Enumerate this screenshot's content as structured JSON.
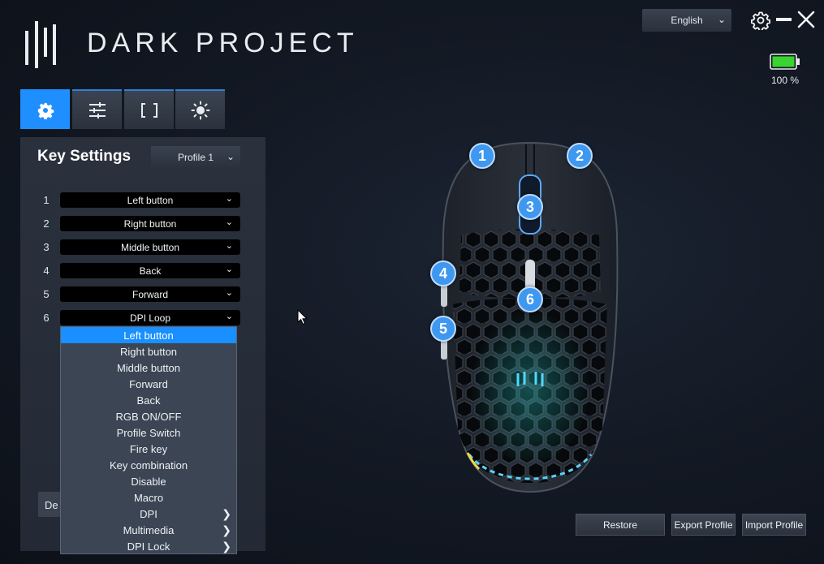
{
  "app": {
    "brand_name": "DARK PROJECT"
  },
  "header": {
    "language": "English",
    "battery_label": "100 %",
    "battery_level": 1.0,
    "battery_color": "#39d42f"
  },
  "tabs": [
    {
      "icon": "gear-icon",
      "active": true
    },
    {
      "icon": "sliders-icon",
      "active": false
    },
    {
      "icon": "brackets-icon",
      "active": false
    },
    {
      "icon": "sun-icon",
      "active": false
    }
  ],
  "key_settings": {
    "title": "Key Settings",
    "profile": "Profile 1",
    "keys": [
      {
        "number": "1",
        "value": "Left button"
      },
      {
        "number": "2",
        "value": "Right button"
      },
      {
        "number": "3",
        "value": "Middle button"
      },
      {
        "number": "4",
        "value": "Back"
      },
      {
        "number": "5",
        "value": "Forward"
      },
      {
        "number": "6",
        "value": "DPI Loop"
      }
    ],
    "default_button_partial": "De"
  },
  "dropdown": {
    "items": [
      {
        "label": "Left button",
        "selected": true,
        "submenu": false
      },
      {
        "label": "Right button",
        "selected": false,
        "submenu": false
      },
      {
        "label": "Middle button",
        "selected": false,
        "submenu": false
      },
      {
        "label": "Forward",
        "selected": false,
        "submenu": false
      },
      {
        "label": "Back",
        "selected": false,
        "submenu": false
      },
      {
        "label": "RGB ON/OFF",
        "selected": false,
        "submenu": false
      },
      {
        "label": "Profile Switch",
        "selected": false,
        "submenu": false
      },
      {
        "label": "Fire key",
        "selected": false,
        "submenu": false
      },
      {
        "label": "Key combination",
        "selected": false,
        "submenu": false
      },
      {
        "label": "Disable",
        "selected": false,
        "submenu": false
      },
      {
        "label": "Macro",
        "selected": false,
        "submenu": false
      },
      {
        "label": "DPI",
        "selected": false,
        "submenu": true
      },
      {
        "label": "Multimedia",
        "selected": false,
        "submenu": true
      },
      {
        "label": "DPI Lock",
        "selected": false,
        "submenu": true
      }
    ],
    "submenu_arrow": "❯"
  },
  "mouse_callouts": [
    "1",
    "2",
    "3",
    "4",
    "5",
    "6"
  ],
  "footer": {
    "restore": "Restore",
    "export_profile": "Export Profile",
    "import_profile": "Import Profile"
  },
  "colors": {
    "accent": "#1f8fff",
    "callout": "#3e98f0"
  }
}
